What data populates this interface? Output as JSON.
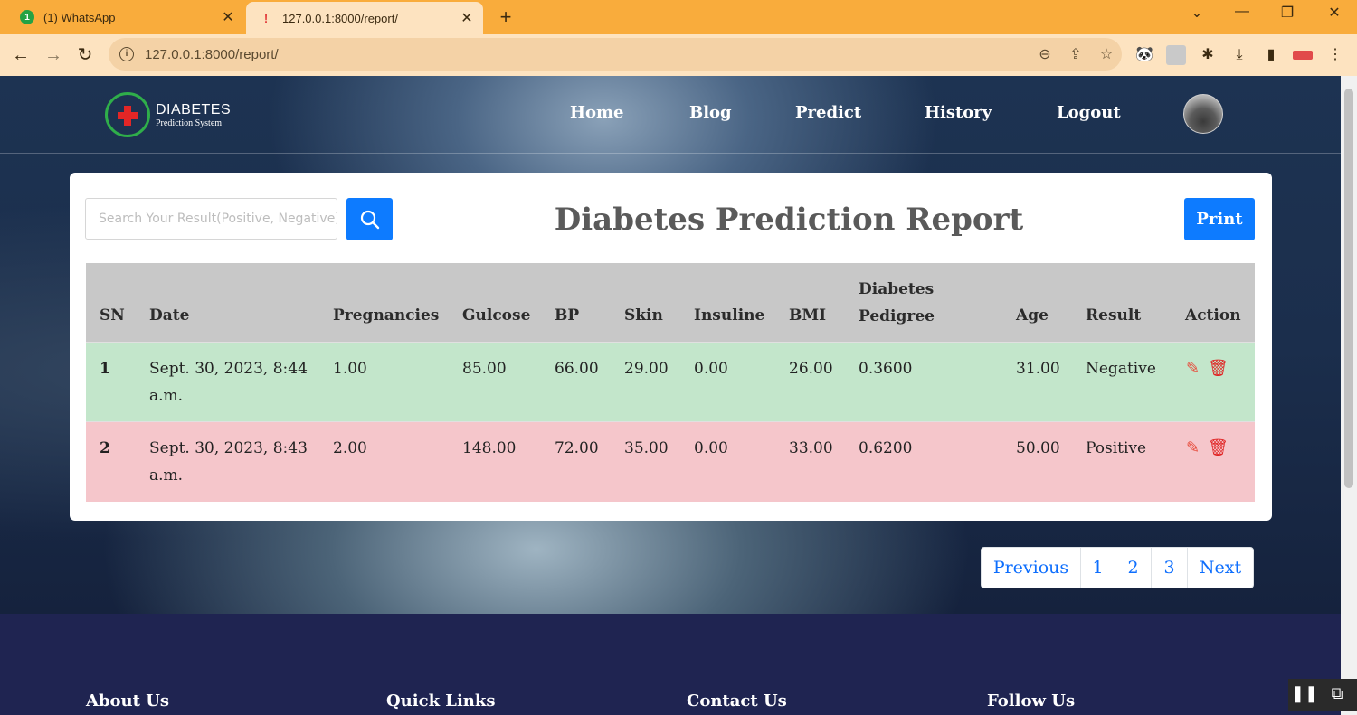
{
  "browser": {
    "tabs": [
      {
        "title": "(1) WhatsApp",
        "badge": "1"
      },
      {
        "title": "127.0.0.1:8000/report/"
      }
    ],
    "url": "127.0.0.1:8000/report/",
    "new_tab_glyph": "+",
    "close_glyph": "✕"
  },
  "site": {
    "logo": {
      "title": "DIABETES",
      "subtitle": "Prediction System"
    },
    "nav": [
      {
        "label": "Home"
      },
      {
        "label": "Blog"
      },
      {
        "label": "Predict"
      },
      {
        "label": "History"
      },
      {
        "label": "Logout"
      }
    ]
  },
  "report": {
    "search_placeholder": "Search Your Result(Positive, Negative)",
    "title": "Diabetes Prediction Report",
    "print_label": "Print",
    "columns": [
      "SN",
      "Date",
      "Pregnancies",
      "Gulcose",
      "BP",
      "Skin",
      "Insuline",
      "BMI",
      "Diabetes Pedigree",
      "Age",
      "Result",
      "Action"
    ],
    "rows": [
      {
        "sn": "1",
        "date": "Sept. 30, 2023, 8:44 a.m.",
        "pregnancies": "1.00",
        "glucose": "85.00",
        "bp": "66.00",
        "skin": "29.00",
        "insulin": "0.00",
        "bmi": "26.00",
        "pedigree": "0.3600",
        "age": "31.00",
        "result": "Negative",
        "status_color": "#c3e6cb"
      },
      {
        "sn": "2",
        "date": "Sept. 30, 2023, 8:43 a.m.",
        "pregnancies": "2.00",
        "glucose": "148.00",
        "bp": "72.00",
        "skin": "35.00",
        "insulin": "0.00",
        "bmi": "33.00",
        "pedigree": "0.6200",
        "age": "50.00",
        "result": "Positive",
        "status_color": "#f5c6cb"
      }
    ]
  },
  "pagination": {
    "previous": "Previous",
    "pages": [
      "1",
      "2",
      "3"
    ],
    "next": "Next"
  },
  "footer": {
    "headings": [
      "About Us",
      "Quick Links",
      "Contact Us",
      "Follow Us"
    ]
  },
  "colors": {
    "accent": "#0d7bff",
    "chrome": "#f9ac3c",
    "footer": "#1f2451"
  }
}
